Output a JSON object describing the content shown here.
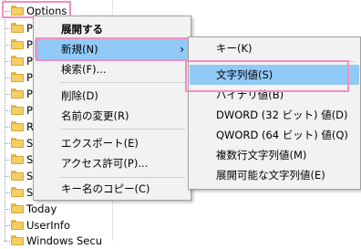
{
  "tree": {
    "items": [
      {
        "label": "Options"
      },
      {
        "label": "P"
      },
      {
        "label": "P"
      },
      {
        "label": "P"
      },
      {
        "label": "P"
      },
      {
        "label": "P"
      },
      {
        "label": "P"
      },
      {
        "label": "R"
      },
      {
        "label": "Sc"
      },
      {
        "label": "Sc"
      },
      {
        "label": "Sc"
      },
      {
        "label": "Sl"
      },
      {
        "label": "Today"
      },
      {
        "label": "UserInfo"
      },
      {
        "label": "Windows Secu"
      }
    ]
  },
  "context_menu": {
    "items": [
      {
        "label": "展開する"
      },
      {
        "label": "新規(N)"
      },
      {
        "label": "検索(F)..."
      },
      {
        "label": "削除(D)"
      },
      {
        "label": "名前の変更(R)"
      },
      {
        "label": "エクスポート(E)"
      },
      {
        "label": "アクセス許可(P)..."
      },
      {
        "label": "キー名のコピー(C)"
      }
    ],
    "submenu_arrow": "›"
  },
  "new_submenu": {
    "items": [
      {
        "label": "キー(K)"
      },
      {
        "label": "文字列値(S)"
      },
      {
        "label": "バイナリ値(B)"
      },
      {
        "label": "DWORD (32 ビット) 値(D)"
      },
      {
        "label": "QWORD (64 ビット) 値(Q)"
      },
      {
        "label": "複数行文字列値(M)"
      },
      {
        "label": "展開可能な文字列値(E)"
      }
    ]
  },
  "colors": {
    "highlight": "#91c9f7",
    "annotation_box": "#f08fc0",
    "folder": "#f5cf63"
  }
}
